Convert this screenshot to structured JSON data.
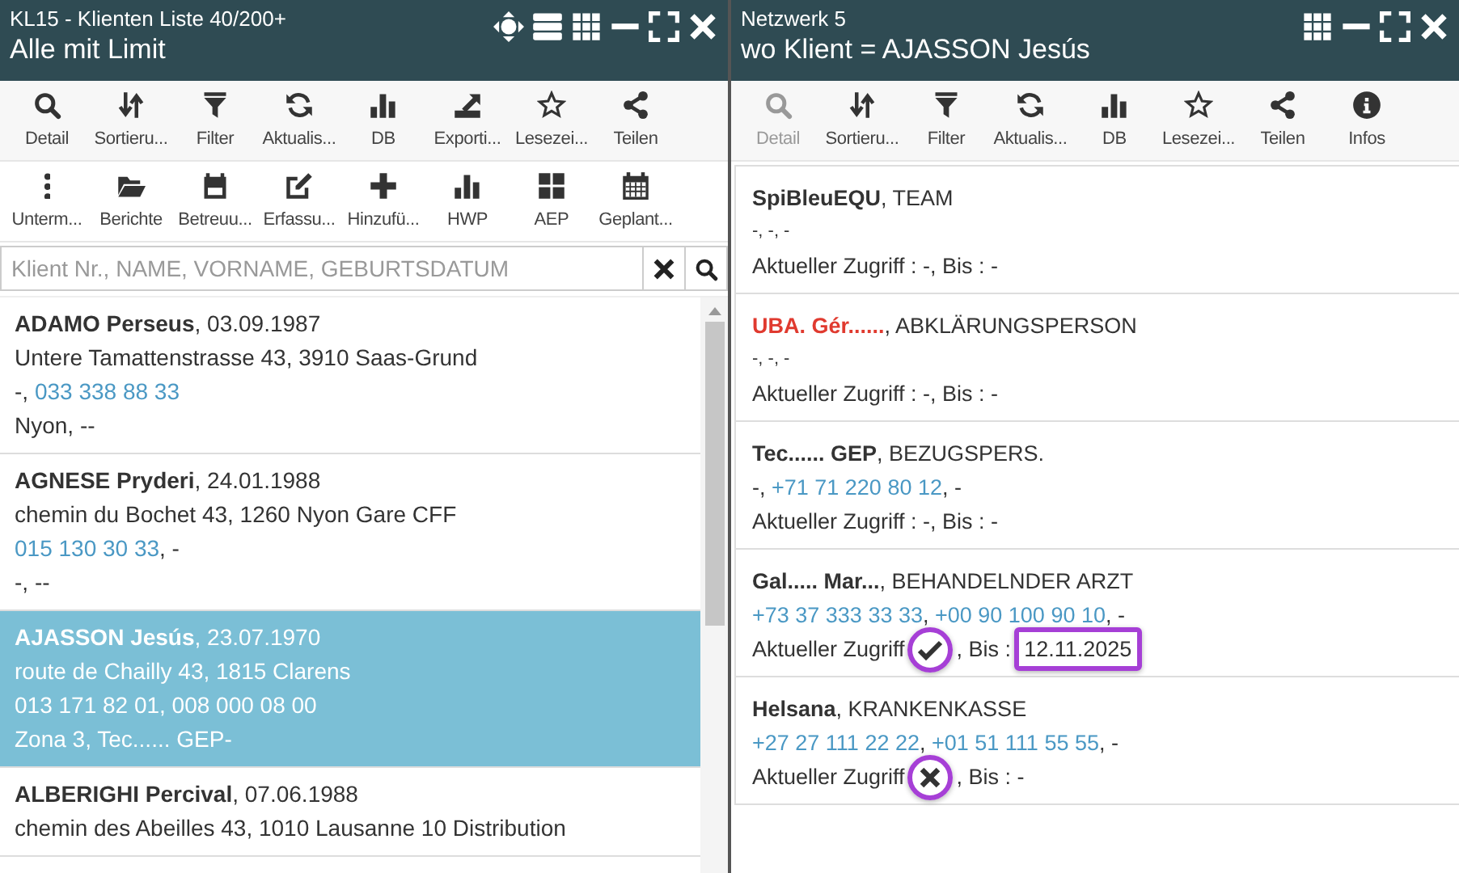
{
  "left_panel": {
    "title": "KL15 - Klienten Liste 40/200+",
    "subtitle": "Alle mit Limit",
    "toolbars": [
      [
        {
          "label": "Detail",
          "disabled": false
        },
        {
          "label": "Sortieru...",
          "disabled": false
        },
        {
          "label": "Filter",
          "disabled": false
        },
        {
          "label": "Aktualis...",
          "disabled": false
        },
        {
          "label": "DB",
          "disabled": false
        },
        {
          "label": "Exporti...",
          "disabled": false
        },
        {
          "label": "Lesezei...",
          "disabled": false
        },
        {
          "label": "Teilen",
          "disabled": false
        }
      ],
      [
        {
          "label": "Unterm...",
          "disabled": false
        },
        {
          "label": "Berichte",
          "disabled": false
        },
        {
          "label": "Betreuu...",
          "disabled": false
        },
        {
          "label": "Erfassu...",
          "disabled": false
        },
        {
          "label": "Hinzufü...",
          "disabled": false
        },
        {
          "label": "HWP",
          "disabled": false
        },
        {
          "label": "AEP",
          "disabled": false
        },
        {
          "label": "Geplant...",
          "disabled": false
        }
      ]
    ],
    "search": {
      "placeholder": "Klient Nr., NAME, VORNAME, GEBURTSDATUM"
    },
    "clients": [
      {
        "name": "ADAMO Perseus",
        "suffix": ", 03.09.1987",
        "selected": false,
        "lines": [
          [
            {
              "kind": "text",
              "text": "Untere Tamattenstrasse 43, 3910 Saas-Grund"
            }
          ],
          [
            {
              "kind": "text",
              "text": "-, "
            },
            {
              "kind": "phone",
              "text": "033 338 88 33"
            }
          ],
          [
            {
              "kind": "text",
              "text": "Nyon, --"
            }
          ]
        ]
      },
      {
        "name": "AGNESE Pryderi",
        "suffix": ", 24.01.1988",
        "selected": false,
        "lines": [
          [
            {
              "kind": "text",
              "text": "chemin du Bochet 43, 1260 Nyon Gare CFF"
            }
          ],
          [
            {
              "kind": "phone",
              "text": "015 130 30 33"
            },
            {
              "kind": "text",
              "text": ", -"
            }
          ],
          [
            {
              "kind": "text",
              "text": "-, --"
            }
          ]
        ]
      },
      {
        "name": "AJASSON Jesús",
        "suffix": ", 23.07.1970",
        "selected": true,
        "lines": [
          [
            {
              "kind": "text",
              "text": "route de Chailly 43, 1815 Clarens"
            }
          ],
          [
            {
              "kind": "text",
              "text": "013 171 82 01, 008 000 08 00"
            }
          ],
          [
            {
              "kind": "text",
              "text": "Zona 3, Tec...... GEP-"
            }
          ]
        ]
      },
      {
        "name": "ALBERIGHI Percival",
        "suffix": ", 07.06.1988",
        "selected": false,
        "lines": [
          [
            {
              "kind": "text",
              "text": "chemin des Abeilles 43, 1010 Lausanne 10 Distribution"
            }
          ]
        ]
      }
    ]
  },
  "right_panel": {
    "title": "Netzwerk 5",
    "subtitle": "wo Klient = AJASSON Jesús",
    "toolbars": [
      [
        {
          "label": "Detail",
          "disabled": true
        },
        {
          "label": "Sortieru...",
          "disabled": false
        },
        {
          "label": "Filter",
          "disabled": false
        },
        {
          "label": "Aktualis...",
          "disabled": false
        },
        {
          "label": "DB",
          "disabled": false
        },
        {
          "label": "Lesezei...",
          "disabled": false
        },
        {
          "label": "Teilen",
          "disabled": false
        },
        {
          "label": "Infos",
          "disabled": false
        }
      ]
    ],
    "contacts": [
      {
        "name": "SpiBleuEQU",
        "alert": false,
        "suffix": ", TEAM",
        "lines": [
          [
            {
              "kind": "text",
              "text": "-, -, -"
            }
          ]
        ],
        "access": {
          "kind": "text",
          "text": "Aktueller Zugriff : -, Bis : -"
        }
      },
      {
        "name": "UBA. Gér......",
        "alert": true,
        "suffix": ", ABKLÄRUNGSPERSON",
        "lines": [
          [
            {
              "kind": "text",
              "text": "-, -, -"
            }
          ]
        ],
        "access": {
          "kind": "text",
          "text": "Aktueller Zugriff : -, Bis : -"
        }
      },
      {
        "name": "Tec...... GEP",
        "alert": false,
        "suffix": ", BEZUGSPERS.",
        "lines": [
          [
            {
              "kind": "text",
              "text": "-, "
            },
            {
              "kind": "phone",
              "text": "+71 71 220 80 12"
            },
            {
              "kind": "text",
              "text": ", -"
            }
          ]
        ],
        "access": {
          "kind": "text",
          "text": "Aktueller Zugriff : -, Bis : -"
        }
      },
      {
        "name": "Gal..... Mar...",
        "alert": false,
        "suffix": ", BEHANDELNDER ARZT",
        "lines": [
          [
            {
              "kind": "phone",
              "text": "+73 37 333 33 33"
            },
            {
              "kind": "text",
              "text": ", "
            },
            {
              "kind": "phone",
              "text": "+00 90 100 90 10"
            },
            {
              "kind": "text",
              "text": ", -"
            }
          ]
        ],
        "access": {
          "kind": "mark",
          "label": "Aktueller Zugriff",
          "granted": true,
          "circled": true,
          "rest": ", Bis :",
          "until": "12.11.2025",
          "until_boxed": true
        }
      },
      {
        "name": "Helsana",
        "alert": false,
        "suffix": ", KRANKENKASSE",
        "lines": [
          [
            {
              "kind": "phone",
              "text": "+27 27 111 22 22"
            },
            {
              "kind": "text",
              "text": ", "
            },
            {
              "kind": "phone",
              "text": "+01 51 111 55 55"
            },
            {
              "kind": "text",
              "text": ", -"
            }
          ]
        ],
        "access": {
          "kind": "mark",
          "label": "Aktueller Zugriff",
          "granted": false,
          "circled": true,
          "rest": ", Bis : -"
        }
      }
    ]
  }
}
